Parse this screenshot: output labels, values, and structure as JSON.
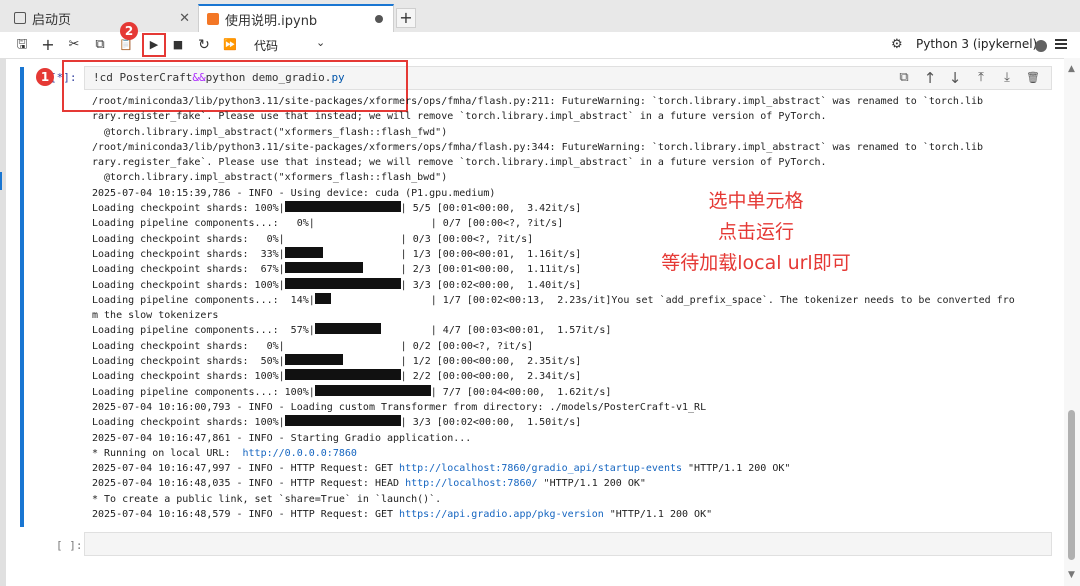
{
  "tabs": [
    {
      "label": "启动页",
      "close": "✕"
    },
    {
      "label": "使用说明.ipynb"
    }
  ],
  "tab_add": "+",
  "toolbar": {
    "save": "🖫",
    "insert": "+",
    "cut": "✂",
    "copy": "⧉",
    "paste": "📋",
    "run": "▶",
    "stop": "■",
    "restart": "↻",
    "run_all": "⏩",
    "cell_type": "代码",
    "cell_type_caret": "⌄",
    "kernel_icon": "⚙",
    "kernel_name": "Python 3 (ipykernel)"
  },
  "cell": {
    "prompt": "[*]:",
    "code_part1": "!cd PosterCraft",
    "code_op": "&&",
    "code_part2": "python demo_gradio.",
    "code_ext": "py",
    "tools": {
      "duplicate": "⧉",
      "move_up": "↑",
      "move_down": "↓",
      "insert_above": "⤒",
      "insert_below": "⤓",
      "delete": "🗑"
    }
  },
  "output": {
    "warn1_a": "/root/miniconda3/lib/python3.11/site-packages/xformers/ops/fmha/flash.py:211: FutureWarning: `torch.library.impl_abstract` was renamed to `torch.lib",
    "warn1_b": "rary.register_fake`. Please use that instead; we will remove `torch.library.impl_abstract` in a future version of PyTorch.",
    "warn1_c": "  @torch.library.impl_abstract(\"xformers_flash::flash_fwd\")",
    "warn2_a": "/root/miniconda3/lib/python3.11/site-packages/xformers/ops/fmha/flash.py:344: FutureWarning: `torch.library.impl_abstract` was renamed to `torch.lib",
    "warn2_b": "rary.register_fake`. Please use that instead; we will remove `torch.library.impl_abstract` in a future version of PyTorch.",
    "warn2_c": "  @torch.library.impl_abstract(\"xformers_flash::flash_bwd\")",
    "info_device": "2025-07-04 10:15:39,786 - INFO - Using device: cuda (P1.gpu.medium)",
    "progress": [
      {
        "pre": "Loading checkpoint shards: 100%|",
        "fill": 1.0,
        "post": "| 5/5 [00:01<00:00,  3.42it/s]"
      },
      {
        "pre": "Loading pipeline components...:   0%|",
        "fill": 0.0,
        "post": "| 0/7 [00:00<?, ?it/s]"
      },
      {
        "pre": "Loading checkpoint shards:   0%|",
        "fill": 0.0,
        "post": "| 0/3 [00:00<?, ?it/s]"
      },
      {
        "pre": "Loading checkpoint shards:  33%|",
        "fill": 0.33,
        "post": "| 1/3 [00:00<00:01,  1.16it/s]"
      },
      {
        "pre": "Loading checkpoint shards:  67%|",
        "fill": 0.67,
        "post": "| 2/3 [00:01<00:00,  1.11it/s]"
      },
      {
        "pre": "Loading checkpoint shards: 100%|",
        "fill": 1.0,
        "post": "| 3/3 [00:02<00:00,  1.40it/s]"
      },
      {
        "pre": "Loading pipeline components...:  14%|",
        "fill": 0.14,
        "post": "| 1/7 [00:02<00:13,  2.23s/it]You set `add_prefix_space`. The tokenizer needs to be converted fro"
      }
    ],
    "tokenizer_tail": "m the slow tokenizers",
    "progress2": [
      {
        "pre": "Loading pipeline components...:  57%|",
        "fill": 0.57,
        "post": "| 4/7 [00:03<00:01,  1.57it/s]"
      },
      {
        "pre": "Loading checkpoint shards:   0%|",
        "fill": 0.0,
        "post": "| 0/2 [00:00<?, ?it/s]"
      },
      {
        "pre": "Loading checkpoint shards:  50%|",
        "fill": 0.5,
        "post": "| 1/2 [00:00<00:00,  2.35it/s]"
      },
      {
        "pre": "Loading checkpoint shards: 100%|",
        "fill": 1.0,
        "post": "| 2/2 [00:00<00:00,  2.34it/s]"
      },
      {
        "pre": "Loading pipeline components...: 100%|",
        "fill": 1.0,
        "post": "| 7/7 [00:04<00:00,  1.62it/s]"
      }
    ],
    "info_custom": "2025-07-04 10:16:00,793 - INFO - Loading custom Transformer from directory: ./models/PosterCraft-v1_RL",
    "progress3": [
      {
        "pre": "Loading checkpoint shards: 100%|",
        "fill": 1.0,
        "post": "| 3/3 [00:02<00:00,  1.50it/s]"
      }
    ],
    "info_gradio": "2025-07-04 10:16:47,861 - INFO - Starting Gradio application...",
    "running_pre": "* Running on local URL:  ",
    "running_url": "http://0.0.0.0:7860",
    "req1_pre": "2025-07-04 10:16:47,997 - INFO - HTTP Request: GET ",
    "req1_url": "http://localhost:7860/gradio_api/startup-events",
    "req1_post": " \"HTTP/1.1 200 OK\"",
    "req2_pre": "2025-07-04 10:16:48,035 - INFO - HTTP Request: HEAD ",
    "req2_url": "http://localhost:7860/",
    "req2_post": " \"HTTP/1.1 200 OK\"",
    "public_link": "* To create a public link, set `share=True` in `launch()`.",
    "req3_pre": "2025-07-04 10:16:48,579 - INFO - HTTP Request: GET ",
    "req3_url": "https://api.gradio.app/pkg-version",
    "req3_post": " \"HTTP/1.1 200 OK\""
  },
  "empty_cell": {
    "prompt": "[ ]:"
  },
  "annotations": {
    "line1": "选中单元格",
    "line2": "点击运行",
    "line3": "等待加载local url即可",
    "badge1": "1",
    "badge2": "2"
  },
  "colors": {
    "accent": "#1976d2",
    "annotation_red": "#e53935"
  }
}
